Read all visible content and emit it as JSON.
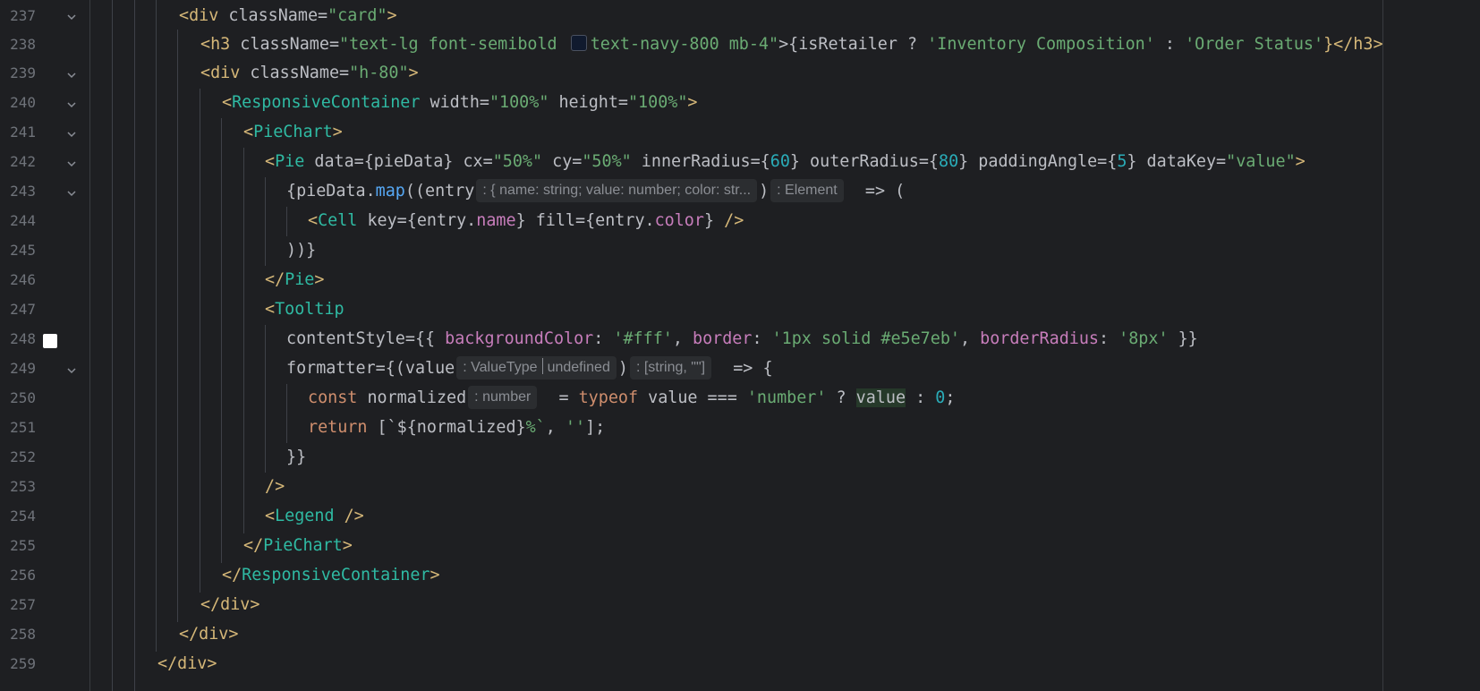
{
  "editor": {
    "line_numbers": [
      "237",
      "238",
      "239",
      "240",
      "241",
      "242",
      "243",
      "244",
      "245",
      "246",
      "247",
      "248",
      "249",
      "250",
      "251",
      "252",
      "253",
      "254",
      "255",
      "256",
      "257",
      "258",
      "259"
    ],
    "colors": {
      "background": "#1e1f22",
      "tag": "#d5b778",
      "component": "#2fbaa3",
      "string": "#6aab73",
      "number": "#2aacb8",
      "keyword": "#cf8e6d",
      "function": "#56a8f5",
      "property": "#c77dbb",
      "swatch_navy": "#101a2e",
      "swatch_white": "#ffffff"
    },
    "icons": {
      "fold": "chevron-down-icon",
      "gutter_color": "color-swatch-icon"
    },
    "hints": {
      "entry_type": ": { name: string; value: number; color: str...",
      "map_return": ": Element",
      "value_type_a": ": ValueType",
      "value_type_b": "undefined",
      "formatter_return": ": [string, \"\"]",
      "normalized_type": ": number"
    },
    "lines": {
      "l237": {
        "a": "<",
        "b": "div",
        "c": " className=",
        "d": "\"card\"",
        "e": ">"
      },
      "l238": {
        "a": "<",
        "b": "h3",
        "c": " className=",
        "d": "\"text-lg font-semibold ",
        "e": "text-navy-800 mb-4\"",
        "f": ">{isRetailer ? ",
        "g": "'Inventory Composition'",
        "h": " : ",
        "i": "'Order Status'",
        "j": "}</",
        "k": "h3",
        "l": ">"
      },
      "l239": {
        "a": "<",
        "b": "div",
        "c": " className=",
        "d": "\"h-80\"",
        "e": ">"
      },
      "l240": {
        "a": "<",
        "b": "ResponsiveContainer",
        "c": " width=",
        "d": "\"100%\"",
        "e": " height=",
        "f": "\"100%\"",
        "g": ">"
      },
      "l241": {
        "a": "<",
        "b": "PieChart",
        "c": ">"
      },
      "l242": {
        "a": "<",
        "b": "Pie",
        "c": " data=",
        "d": "{pieData}",
        "e": " cx=",
        "f": "\"50%\"",
        "g": " cy=",
        "h": "\"50%\"",
        "i": " innerRadius=",
        "j": "{",
        "k": "60",
        "l": "}",
        "m": " outerRadius=",
        "n": "{",
        "o": "80",
        "p": "}",
        "q": " paddingAngle=",
        "r": "{",
        "s": "5",
        "t": "}",
        "u": " dataKey=",
        "v": "\"value\"",
        "w": ">"
      },
      "l243": {
        "a": "{pieData.",
        "b": "map",
        "c": "((entry",
        "d": ")",
        "e": "  => ("
      },
      "l244": {
        "a": "<",
        "b": "Cell",
        "c": " key=",
        "d": "{entry.",
        "e": "name",
        "f": "}",
        "g": " fill=",
        "h": "{entry.",
        "i": "color",
        "j": "}",
        "k": " />"
      },
      "l245": {
        "a": "))}"
      },
      "l246": {
        "a": "</",
        "b": "Pie",
        "c": ">"
      },
      "l247": {
        "a": "<",
        "b": "Tooltip"
      },
      "l248": {
        "a": "contentStyle=",
        "b": "{{ ",
        "c": "backgroundColor",
        "d": ": ",
        "e": "'#fff'",
        "f": ", ",
        "g": "border",
        "h": ": ",
        "i": "'1px solid #e5e7eb'",
        "j": ", ",
        "k": "borderRadius",
        "l": ": ",
        "m": "'8px'",
        "n": " }}"
      },
      "l249": {
        "a": "formatter=",
        "b": "{(value",
        "c": ")",
        "d": "  => {"
      },
      "l250": {
        "a": "const ",
        "b": "normalized",
        "c": "  = ",
        "d": "typeof ",
        "e": "value === ",
        "f": "'number'",
        "g": " ? ",
        "h": "value",
        "i": " : ",
        "j": "0",
        "k": ";"
      },
      "l251": {
        "a": "return ",
        "b": "[`${normalized}",
        "c": "%`",
        "d": ", ",
        "e": "''",
        "f": "];"
      },
      "l252": {
        "a": "}}"
      },
      "l253": {
        "a": "/>"
      },
      "l254": {
        "a": "<",
        "b": "Legend",
        "c": " />"
      },
      "l255": {
        "a": "</",
        "b": "PieChart",
        "c": ">"
      },
      "l256": {
        "a": "</",
        "b": "ResponsiveContainer",
        "c": ">"
      },
      "l257": {
        "a": "</",
        "b": "div",
        "c": ">"
      },
      "l258": {
        "a": "</",
        "b": "div",
        "c": ">"
      },
      "l259": {
        "a": "</",
        "b": "div",
        "c": ">"
      }
    }
  }
}
